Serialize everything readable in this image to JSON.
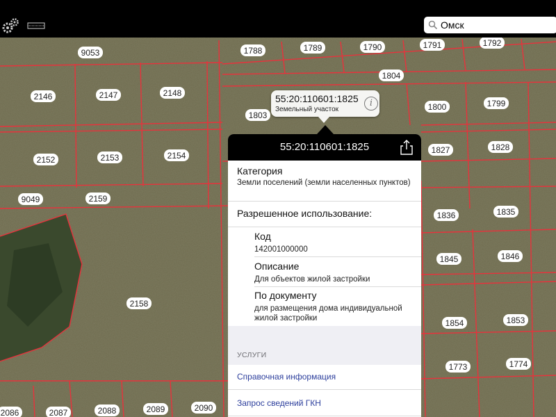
{
  "search": {
    "value": "Омск",
    "placeholder": ""
  },
  "map": {
    "parcel_labels": [
      "9053",
      "1788",
      "1789",
      "1790",
      "1791",
      "1792",
      "1804",
      "2146",
      "2147",
      "2148",
      "1803",
      "1800",
      "1799",
      "2152",
      "2153",
      "2154",
      "1827",
      "1828",
      "9049",
      "2159",
      "1836",
      "1835",
      "1845",
      "1846",
      "2158",
      "1854",
      "1853",
      "1773",
      "1774",
      "2086",
      "2087",
      "2088",
      "2089",
      "2090"
    ]
  },
  "callout": {
    "title": "55:20:110601:1825",
    "subtitle": "Земельный участок",
    "info_glyph": "i"
  },
  "popover": {
    "title": "55:20:110601:1825",
    "category_label": "Категория",
    "category_value": "Земли поселений (земли населенных пунктов)",
    "permitted_use_label": "Разрешенное использование:",
    "code_label": "Код",
    "code_value": "142001000000",
    "description_label": "Описание",
    "description_value": "Для объектов жилой застройки",
    "by_document_label": "По документу",
    "by_document_value": "для размещения дома индивидуальной жилой застройки",
    "services_header": "УСЛУГИ",
    "services": [
      "Справочная информация",
      "Запрос сведений ГКН"
    ]
  },
  "colors": {
    "parcel_line": "#e8323c",
    "link": "#2c3e9c",
    "field": "#6b6a4c",
    "forest": "#3a4a2c"
  }
}
